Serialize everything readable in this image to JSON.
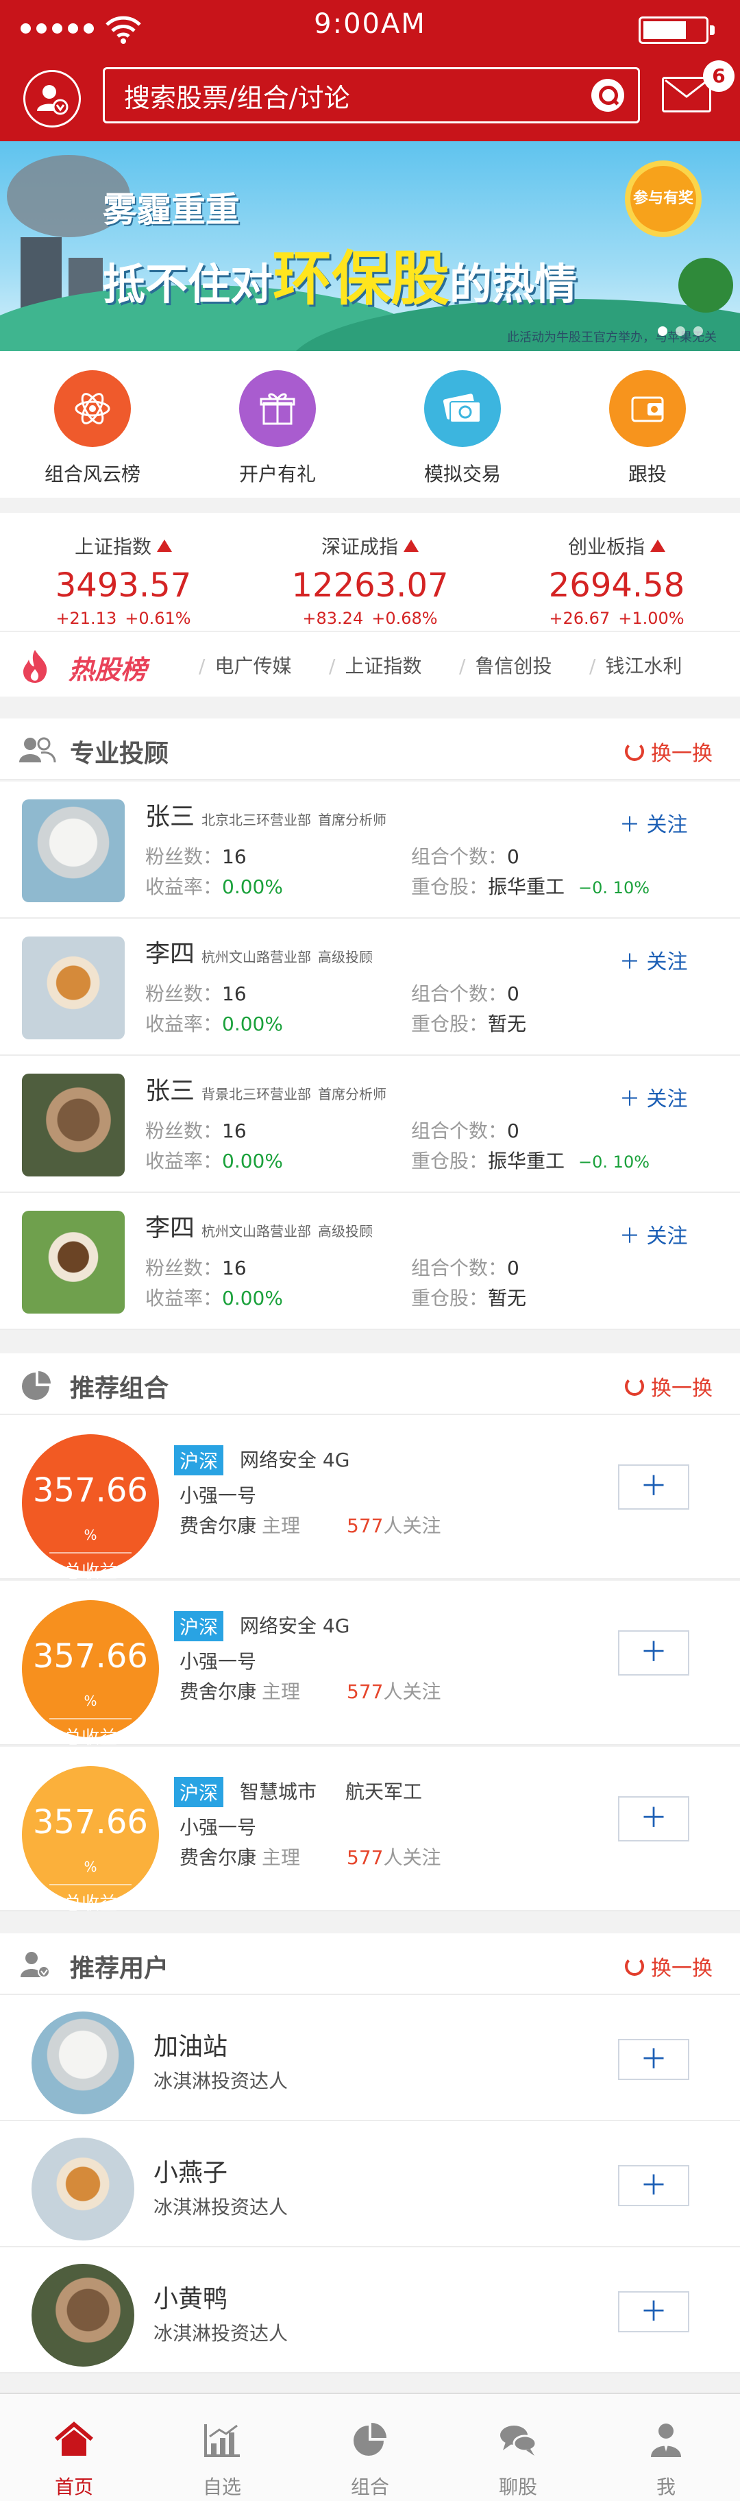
{
  "status": {
    "time": "9:00AM"
  },
  "header": {
    "search_placeholder": "搜索股票/组合/讨论",
    "mail_badge": "6"
  },
  "banner": {
    "line1": "雾霾重重",
    "line2_pre": "抵不住对",
    "line2_hl": "环保股",
    "line2_post": "的热情",
    "prize": "参与有奖",
    "note": "此活动为牛股王官方举办，与苹果无关"
  },
  "quick_menu": [
    {
      "label": "组合风云榜",
      "icon": "atom-icon",
      "color": "#ef5a2c"
    },
    {
      "label": "开户有礼",
      "icon": "gift-icon",
      "color": "#a95ccf"
    },
    {
      "label": "模拟交易",
      "icon": "money-icon",
      "color": "#3cb5df"
    },
    {
      "label": "跟投",
      "icon": "wallet-icon",
      "color": "#f7941d"
    }
  ],
  "indices": [
    {
      "name": "上证指数",
      "value": "3493.57",
      "change": "+21.13",
      "pct": "+0.61%"
    },
    {
      "name": "深证成指",
      "value": "12263.07",
      "change": "+83.24",
      "pct": "+0.68%"
    },
    {
      "name": "创业板指",
      "value": "2694.58",
      "change": "+26.67",
      "pct": "+1.00%"
    }
  ],
  "hot": {
    "title": "热股榜",
    "tags": [
      "电广传媒",
      "上证指数",
      "鲁信创投",
      "钱江水利"
    ]
  },
  "advisors": {
    "title": "专业投顾",
    "refresh": "换一换",
    "fans_label": "粉丝数：",
    "yield_label": "收益率：",
    "count_label": "组合个数：",
    "holding_label": "重仓股：",
    "follow_label": "关注",
    "items": [
      {
        "name": "张三",
        "org": "北京北三环营业部",
        "role": "首席分析师",
        "fans": "16",
        "yield": "0.00%",
        "count": "0",
        "holding": "振华重工",
        "holding_chg": "−0. 10%",
        "pic": "pic-seal"
      },
      {
        "name": "李四",
        "org": "杭州文山路营业部",
        "role": "高级投顾",
        "fans": "16",
        "yield": "0.00%",
        "count": "0",
        "holding": "暂无",
        "holding_chg": "",
        "pic": "pic-dog"
      },
      {
        "name": "张三",
        "org": "背景北三环营业部",
        "role": "首席分析师",
        "fans": "16",
        "yield": "0.00%",
        "count": "0",
        "holding": "振华重工",
        "holding_chg": "−0. 10%",
        "pic": "pic-squirrel"
      },
      {
        "name": "李四",
        "org": "杭州文山路营业部",
        "role": "高级投顾",
        "fans": "16",
        "yield": "0.00%",
        "count": "0",
        "holding": "暂无",
        "holding_chg": "",
        "pic": "pic-beagle"
      }
    ]
  },
  "portfolios": {
    "title": "推荐组合",
    "refresh": "换一换",
    "items": [
      {
        "value": "357.66",
        "unit": "%",
        "caption": "总收益",
        "market": "沪深",
        "theme": "网络安全 4G",
        "theme2": "",
        "name": "小强一号",
        "manager": "费舍尔康",
        "role": "主理",
        "fans": "577",
        "fans_suffix": "人关注",
        "color": "#f25a23"
      },
      {
        "value": "357.66",
        "unit": "%",
        "caption": "总收益",
        "market": "沪深",
        "theme": "网络安全 4G",
        "theme2": "",
        "name": "小强一号",
        "manager": "费舍尔康",
        "role": "主理",
        "fans": "577",
        "fans_suffix": "人关注",
        "color": "#f7901e"
      },
      {
        "value": "357.66",
        "unit": "%",
        "caption": "总收益",
        "market": "沪深",
        "theme": "智慧城市",
        "theme2": "航天军工",
        "name": "小强一号",
        "manager": "费舍尔康",
        "role": "主理",
        "fans": "577",
        "fans_suffix": "人关注",
        "color": "#fbb03b"
      }
    ]
  },
  "users": {
    "title": "推荐用户",
    "refresh": "换一换",
    "items": [
      {
        "name": "加油站",
        "desc": "冰淇淋投资达人",
        "pic": "pic-seal"
      },
      {
        "name": "小燕子",
        "desc": "冰淇淋投资达人",
        "pic": "pic-dog"
      },
      {
        "name": "小黄鸭",
        "desc": "冰淇淋投资达人",
        "pic": "pic-squirrel"
      }
    ]
  },
  "tabbar": [
    {
      "label": "首页",
      "icon": "home-icon",
      "active": true
    },
    {
      "label": "自选",
      "icon": "chart-icon",
      "active": false
    },
    {
      "label": "组合",
      "icon": "pie-icon",
      "active": false
    },
    {
      "label": "聊股",
      "icon": "chat-icon",
      "active": false
    },
    {
      "label": "我",
      "icon": "person-icon",
      "active": false
    }
  ],
  "colors": {
    "brand": "#c8141a",
    "rise": "#d42323",
    "gain": "#1aa13b",
    "link": "#1c5fb5"
  }
}
